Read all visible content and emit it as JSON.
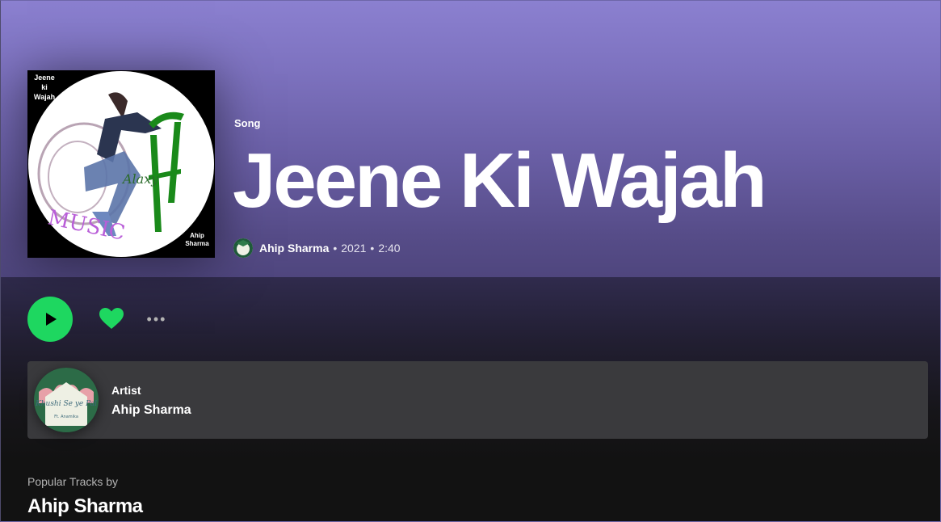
{
  "header": {
    "type_label": "Song",
    "title": "Jeene Ki Wajah",
    "artist": "Ahip Sharma",
    "separator": "•",
    "year": "2021",
    "duration": "2:40"
  },
  "cover": {
    "title_text": "Jeene ki Wajah",
    "artist_text": "Ahip Sharma",
    "logo_text": "MUSIC",
    "logo_sub": "Alaxy"
  },
  "actions": {
    "play_icon": "play-icon",
    "like_icon": "heart-icon",
    "more_icon": "ellipsis-icon",
    "more_label": "•••",
    "accent_color": "#1ed760"
  },
  "artist_card": {
    "kind_label": "Artist",
    "name": "Ahip Sharma",
    "avatar_text": "Khushi Se ye Pal",
    "avatar_sub": "Ft. Anamika"
  },
  "popular": {
    "label": "Popular Tracks by",
    "artist": "Ahip Sharma"
  },
  "colors": {
    "hero_top": "#8b80d0",
    "hero_bottom": "#4f467e",
    "background": "#121212",
    "card": "#3a3a3d"
  }
}
